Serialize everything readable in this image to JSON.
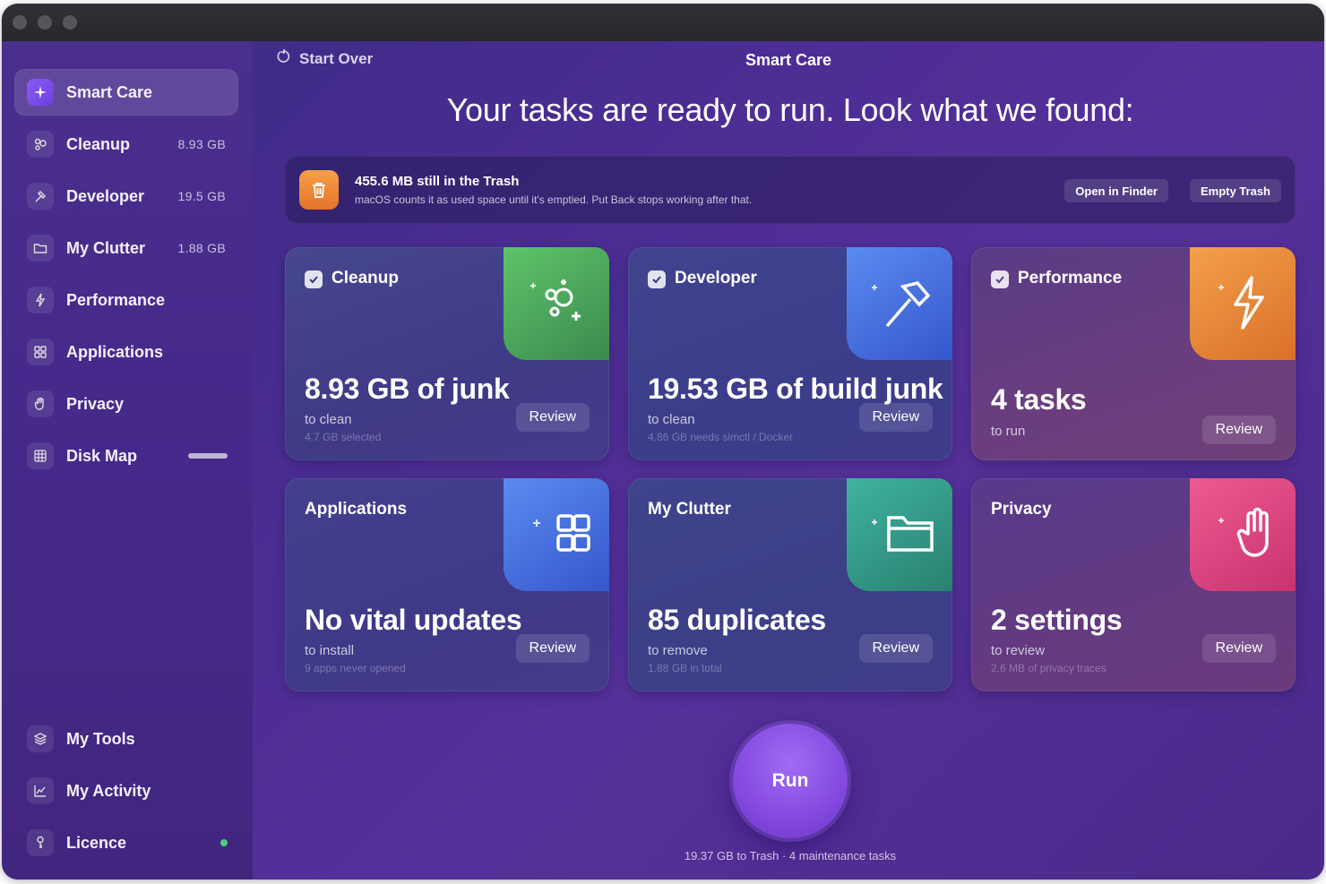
{
  "sidebar": {
    "items": [
      {
        "label": "Smart Care",
        "value": ""
      },
      {
        "label": "Cleanup",
        "value": "8.93 GB"
      },
      {
        "label": "Developer",
        "value": "19.5 GB"
      },
      {
        "label": "My Clutter",
        "value": "1.88 GB"
      },
      {
        "label": "Performance",
        "value": ""
      },
      {
        "label": "Applications",
        "value": ""
      },
      {
        "label": "Privacy",
        "value": ""
      },
      {
        "label": "Disk Map",
        "value": ""
      }
    ],
    "bottom": [
      {
        "label": "My Tools"
      },
      {
        "label": "My Activity"
      },
      {
        "label": "Licence",
        "status_color": "#4ad27a"
      }
    ]
  },
  "header": {
    "start_over": "Start Over",
    "title": "Smart Care",
    "headline": "Your tasks are ready to run. Look what we found:"
  },
  "banner": {
    "title": "455.6 MB still in the Trash",
    "subtitle": "macOS counts it as used space until it's emptied. Put Back stops working after that.",
    "open_in_finder": "Open in Finder",
    "empty_trash": "Empty Trash"
  },
  "cards": [
    {
      "title": "Cleanup",
      "checked": true,
      "value": "8.93 GB of junk",
      "sub": "to clean",
      "note": "4.7 GB selected",
      "review": "Review",
      "icon": "sparkles-icon",
      "color": "#4aa85a"
    },
    {
      "title": "Developer",
      "checked": true,
      "value": "19.53 GB of build junk",
      "sub": "to clean",
      "note": "4.86 GB needs simctl / Docker",
      "review": "Review",
      "icon": "hammer-icon",
      "color": "#3a6fe0"
    },
    {
      "title": "Performance",
      "checked": true,
      "value": "4 tasks",
      "sub": "to run",
      "note": "",
      "review": "Review",
      "icon": "lightning-icon",
      "color": "#e8852e"
    },
    {
      "title": "Applications",
      "checked": false,
      "value": "No vital updates",
      "sub": "to install",
      "note": "9 apps never opened",
      "review": "Review",
      "icon": "grid-icon",
      "color": "#3a6fe0"
    },
    {
      "title": "My Clutter",
      "checked": false,
      "value": "85 duplicates",
      "sub": "to remove",
      "note": "1.88 GB in total",
      "review": "Review",
      "icon": "folder-icon",
      "color": "#2f9e8a"
    },
    {
      "title": "Privacy",
      "checked": false,
      "value": "2 settings",
      "sub": "to review",
      "note": "2.6 MB of privacy traces",
      "review": "Review",
      "icon": "hand-icon",
      "color": "#e0437e"
    }
  ],
  "run": {
    "label": "Run",
    "note": "19.37 GB to Trash · 4 maintenance tasks"
  }
}
